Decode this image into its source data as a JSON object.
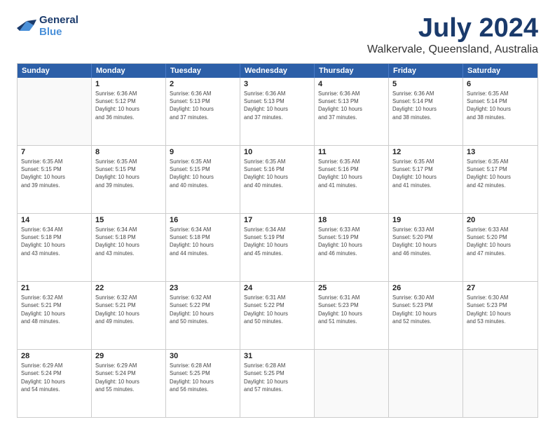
{
  "logo": {
    "line1": "General",
    "line2": "Blue"
  },
  "title": "July 2024",
  "subtitle": "Walkervale, Queensland, Australia",
  "header_days": [
    "Sunday",
    "Monday",
    "Tuesday",
    "Wednesday",
    "Thursday",
    "Friday",
    "Saturday"
  ],
  "weeks": [
    [
      {
        "day": "",
        "info": ""
      },
      {
        "day": "1",
        "info": "Sunrise: 6:36 AM\nSunset: 5:12 PM\nDaylight: 10 hours\nand 36 minutes."
      },
      {
        "day": "2",
        "info": "Sunrise: 6:36 AM\nSunset: 5:13 PM\nDaylight: 10 hours\nand 37 minutes."
      },
      {
        "day": "3",
        "info": "Sunrise: 6:36 AM\nSunset: 5:13 PM\nDaylight: 10 hours\nand 37 minutes."
      },
      {
        "day": "4",
        "info": "Sunrise: 6:36 AM\nSunset: 5:13 PM\nDaylight: 10 hours\nand 37 minutes."
      },
      {
        "day": "5",
        "info": "Sunrise: 6:36 AM\nSunset: 5:14 PM\nDaylight: 10 hours\nand 38 minutes."
      },
      {
        "day": "6",
        "info": "Sunrise: 6:35 AM\nSunset: 5:14 PM\nDaylight: 10 hours\nand 38 minutes."
      }
    ],
    [
      {
        "day": "7",
        "info": "Sunrise: 6:35 AM\nSunset: 5:15 PM\nDaylight: 10 hours\nand 39 minutes."
      },
      {
        "day": "8",
        "info": "Sunrise: 6:35 AM\nSunset: 5:15 PM\nDaylight: 10 hours\nand 39 minutes."
      },
      {
        "day": "9",
        "info": "Sunrise: 6:35 AM\nSunset: 5:15 PM\nDaylight: 10 hours\nand 40 minutes."
      },
      {
        "day": "10",
        "info": "Sunrise: 6:35 AM\nSunset: 5:16 PM\nDaylight: 10 hours\nand 40 minutes."
      },
      {
        "day": "11",
        "info": "Sunrise: 6:35 AM\nSunset: 5:16 PM\nDaylight: 10 hours\nand 41 minutes."
      },
      {
        "day": "12",
        "info": "Sunrise: 6:35 AM\nSunset: 5:17 PM\nDaylight: 10 hours\nand 41 minutes."
      },
      {
        "day": "13",
        "info": "Sunrise: 6:35 AM\nSunset: 5:17 PM\nDaylight: 10 hours\nand 42 minutes."
      }
    ],
    [
      {
        "day": "14",
        "info": "Sunrise: 6:34 AM\nSunset: 5:18 PM\nDaylight: 10 hours\nand 43 minutes."
      },
      {
        "day": "15",
        "info": "Sunrise: 6:34 AM\nSunset: 5:18 PM\nDaylight: 10 hours\nand 43 minutes."
      },
      {
        "day": "16",
        "info": "Sunrise: 6:34 AM\nSunset: 5:18 PM\nDaylight: 10 hours\nand 44 minutes."
      },
      {
        "day": "17",
        "info": "Sunrise: 6:34 AM\nSunset: 5:19 PM\nDaylight: 10 hours\nand 45 minutes."
      },
      {
        "day": "18",
        "info": "Sunrise: 6:33 AM\nSunset: 5:19 PM\nDaylight: 10 hours\nand 46 minutes."
      },
      {
        "day": "19",
        "info": "Sunrise: 6:33 AM\nSunset: 5:20 PM\nDaylight: 10 hours\nand 46 minutes."
      },
      {
        "day": "20",
        "info": "Sunrise: 6:33 AM\nSunset: 5:20 PM\nDaylight: 10 hours\nand 47 minutes."
      }
    ],
    [
      {
        "day": "21",
        "info": "Sunrise: 6:32 AM\nSunset: 5:21 PM\nDaylight: 10 hours\nand 48 minutes."
      },
      {
        "day": "22",
        "info": "Sunrise: 6:32 AM\nSunset: 5:21 PM\nDaylight: 10 hours\nand 49 minutes."
      },
      {
        "day": "23",
        "info": "Sunrise: 6:32 AM\nSunset: 5:22 PM\nDaylight: 10 hours\nand 50 minutes."
      },
      {
        "day": "24",
        "info": "Sunrise: 6:31 AM\nSunset: 5:22 PM\nDaylight: 10 hours\nand 50 minutes."
      },
      {
        "day": "25",
        "info": "Sunrise: 6:31 AM\nSunset: 5:23 PM\nDaylight: 10 hours\nand 51 minutes."
      },
      {
        "day": "26",
        "info": "Sunrise: 6:30 AM\nSunset: 5:23 PM\nDaylight: 10 hours\nand 52 minutes."
      },
      {
        "day": "27",
        "info": "Sunrise: 6:30 AM\nSunset: 5:23 PM\nDaylight: 10 hours\nand 53 minutes."
      }
    ],
    [
      {
        "day": "28",
        "info": "Sunrise: 6:29 AM\nSunset: 5:24 PM\nDaylight: 10 hours\nand 54 minutes."
      },
      {
        "day": "29",
        "info": "Sunrise: 6:29 AM\nSunset: 5:24 PM\nDaylight: 10 hours\nand 55 minutes."
      },
      {
        "day": "30",
        "info": "Sunrise: 6:28 AM\nSunset: 5:25 PM\nDaylight: 10 hours\nand 56 minutes."
      },
      {
        "day": "31",
        "info": "Sunrise: 6:28 AM\nSunset: 5:25 PM\nDaylight: 10 hours\nand 57 minutes."
      },
      {
        "day": "",
        "info": ""
      },
      {
        "day": "",
        "info": ""
      },
      {
        "day": "",
        "info": ""
      }
    ]
  ]
}
